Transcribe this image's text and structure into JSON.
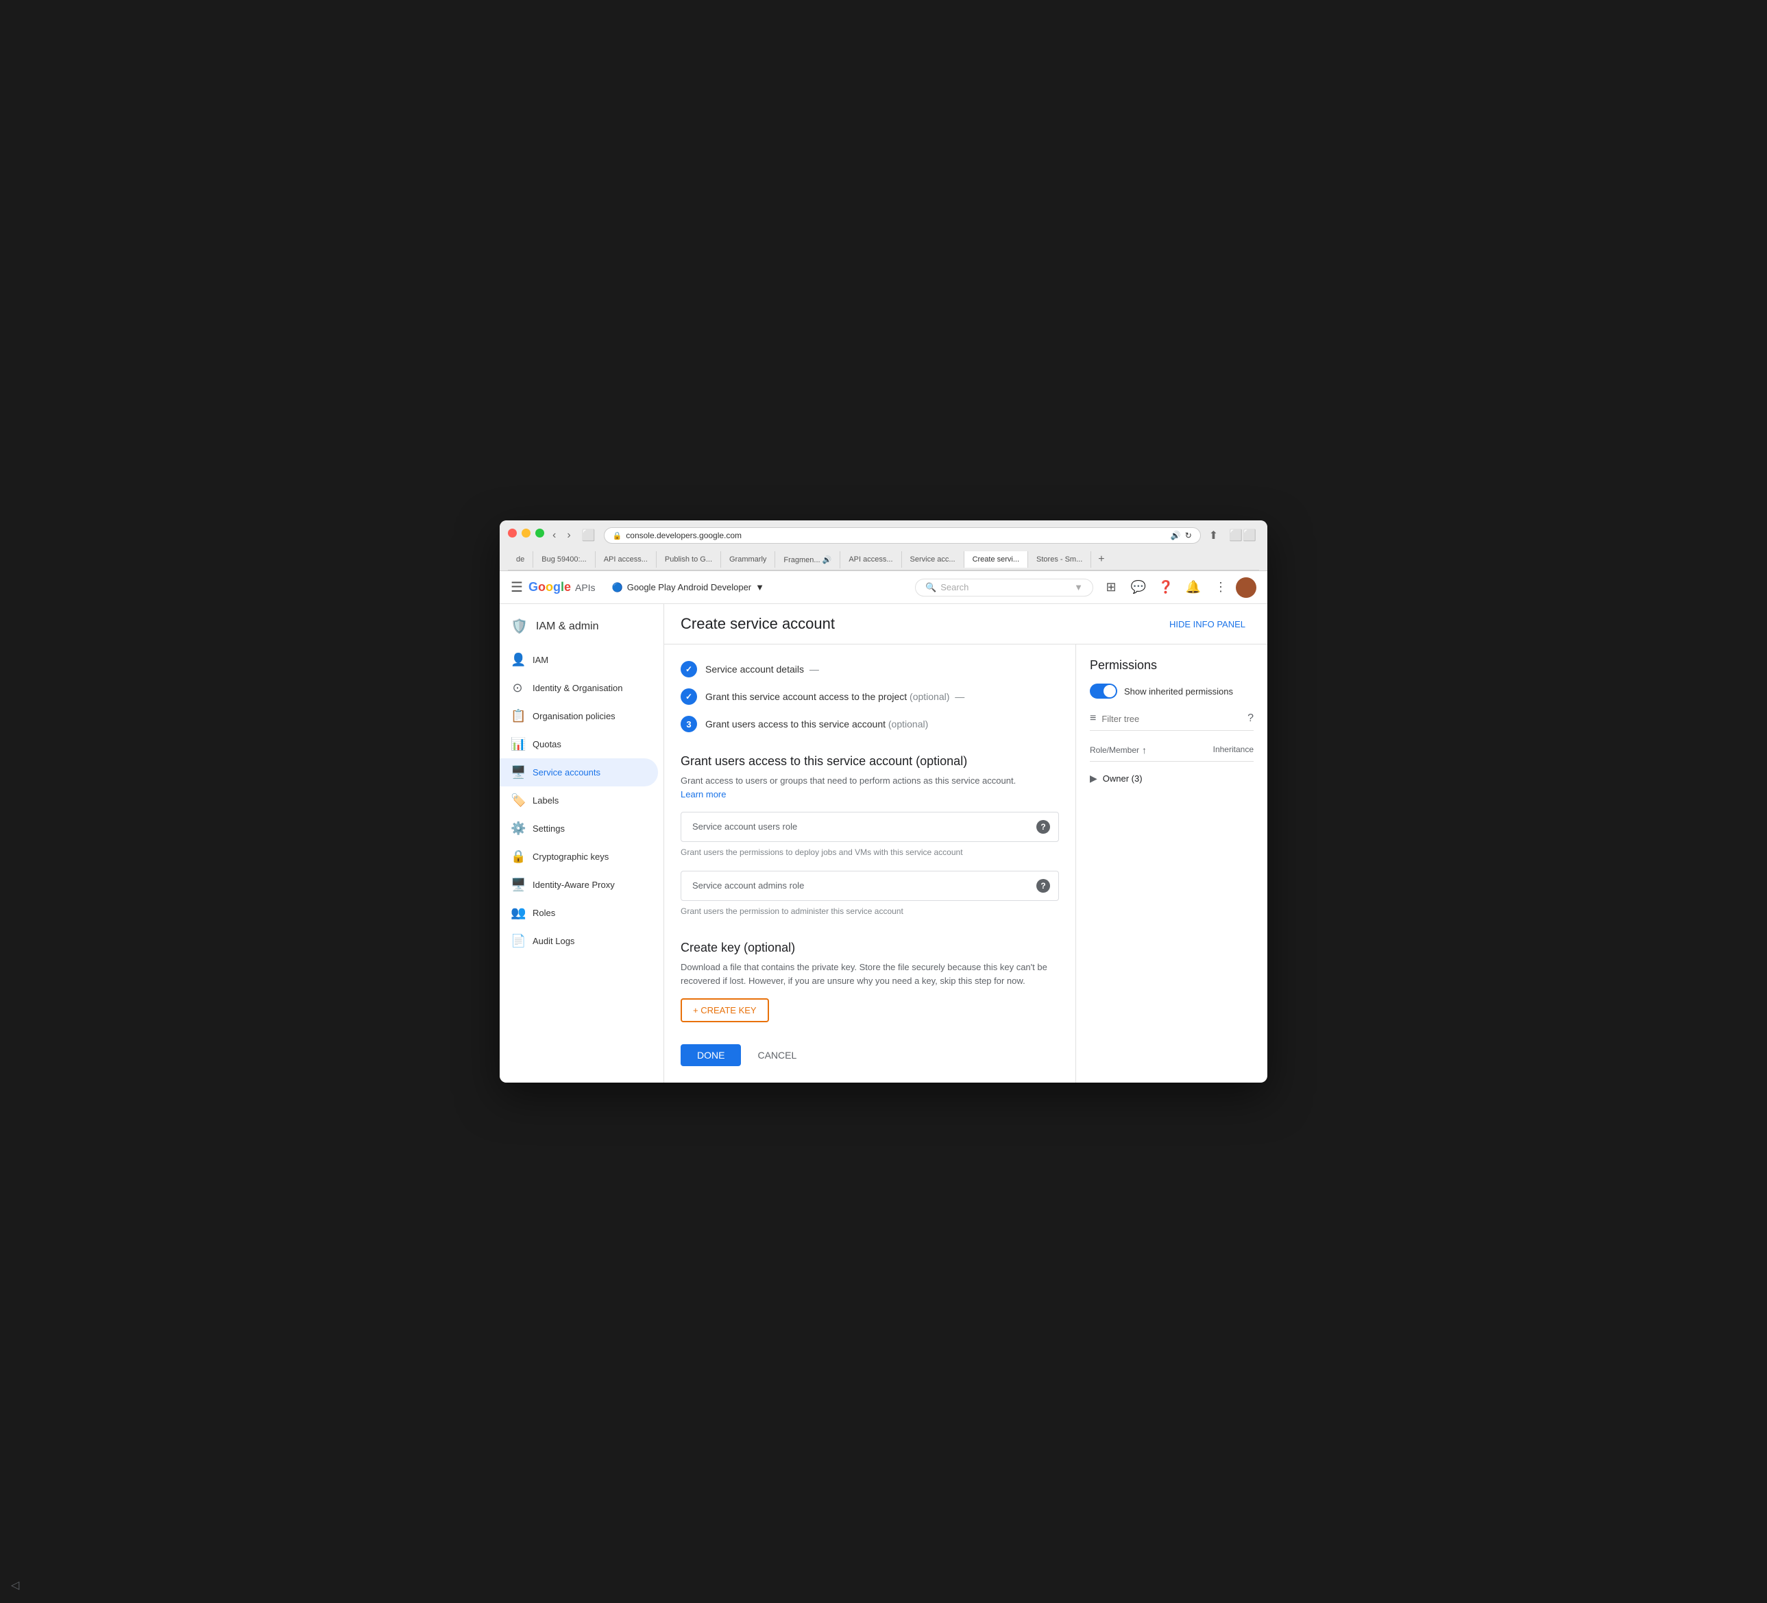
{
  "browser": {
    "tabs": [
      {
        "label": "de",
        "active": false
      },
      {
        "label": "Bug 59400:...",
        "active": false
      },
      {
        "label": "API access...",
        "active": false
      },
      {
        "label": "Publish to G...",
        "active": false
      },
      {
        "label": "Grammarly",
        "active": false
      },
      {
        "label": "Fragmen... 🔊",
        "active": false
      },
      {
        "label": "API access...",
        "active": false
      },
      {
        "label": "Service acc...",
        "active": false
      },
      {
        "label": "Create servi...",
        "active": true
      },
      {
        "label": "Stores - Sm...",
        "active": false
      }
    ],
    "address": "console.developers.google.com"
  },
  "appbar": {
    "logo": "Google APIs",
    "project_name": "Google Play Android Developer",
    "search_placeholder": "Search"
  },
  "sidebar": {
    "header": "IAM & admin",
    "items": [
      {
        "id": "iam",
        "label": "IAM",
        "icon": "👤"
      },
      {
        "id": "identity",
        "label": "Identity & Organisation",
        "icon": "🔘"
      },
      {
        "id": "org-policies",
        "label": "Organisation policies",
        "icon": "📋"
      },
      {
        "id": "quotas",
        "label": "Quotas",
        "icon": "📊"
      },
      {
        "id": "service-accounts",
        "label": "Service accounts",
        "icon": "🖥️",
        "active": true
      },
      {
        "id": "labels",
        "label": "Labels",
        "icon": "🏷️"
      },
      {
        "id": "settings",
        "label": "Settings",
        "icon": "⚙️"
      },
      {
        "id": "cryptographic-keys",
        "label": "Cryptographic keys",
        "icon": "🔒"
      },
      {
        "id": "identity-aware-proxy",
        "label": "Identity-Aware Proxy",
        "icon": "🖥️"
      },
      {
        "id": "roles",
        "label": "Roles",
        "icon": "👥"
      },
      {
        "id": "audit-logs",
        "label": "Audit Logs",
        "icon": "📄"
      }
    ]
  },
  "page": {
    "title": "Create service account",
    "hide_panel_label": "HIDE INFO PANEL"
  },
  "steps": [
    {
      "number": "✓",
      "label": "Service account details",
      "suffix": "—",
      "done": true
    },
    {
      "number": "✓",
      "label": "Grant this service account access to the project",
      "optional": "(optional)",
      "suffix": "—",
      "done": true
    },
    {
      "number": "3",
      "label": "Grant users access to this service account",
      "optional": "(optional)",
      "current": true
    }
  ],
  "form": {
    "grant_title": "Grant users access to this service account (optional)",
    "grant_desc": "Grant access to users or groups that need to perform actions as this service account.",
    "learn_more": "Learn more",
    "users_role_placeholder": "Service account users role",
    "users_role_hint": "Grant users the permissions to deploy jobs and VMs with this service account",
    "admins_role_placeholder": "Service account admins role",
    "admins_role_hint": "Grant users the permission to administer this service account",
    "create_key_title": "Create key (optional)",
    "create_key_desc": "Download a file that contains the private key. Store the file securely because this key can't be recovered if lost. However, if you are unsure why you need a key, skip this step for now.",
    "create_key_btn": "+ CREATE KEY",
    "done_btn": "DONE",
    "cancel_btn": "CANCEL"
  },
  "permissions_panel": {
    "title": "Permissions",
    "toggle_label": "Show inherited permissions",
    "filter_placeholder": "Filter tree",
    "role_member_label": "Role/Member",
    "inheritance_label": "Inheritance",
    "owner_label": "Owner (3)"
  }
}
